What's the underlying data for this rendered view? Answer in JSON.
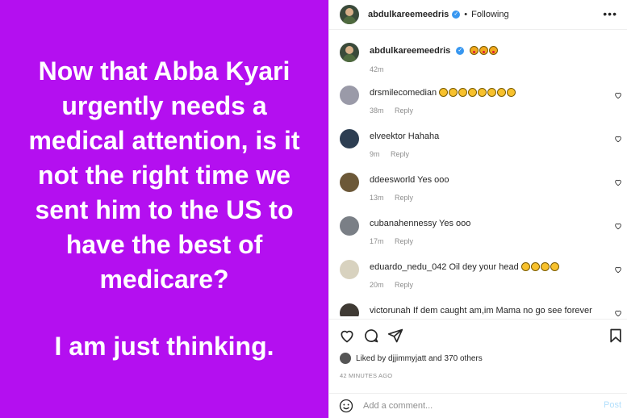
{
  "post": {
    "background_color": "#b40ff0",
    "text_main": "Now that Abba Kyari\nurgently needs a\nmedical attention, is it\nnot the right time we\nsent him to the US to\nhave the best of\nmedicare?",
    "text_secondary": "I am just thinking."
  },
  "header": {
    "username": "abdulkareemeedris",
    "separator": "•",
    "following_label": "Following"
  },
  "caption": {
    "username": "abdulkareemeedris",
    "time": "42m"
  },
  "comments": [
    {
      "username": "drsmilecomedian",
      "text": "",
      "time": "38m",
      "reply": "Reply"
    },
    {
      "username": "elveektor",
      "text": "Hahaha",
      "time": "9m",
      "reply": "Reply"
    },
    {
      "username": "ddeesworld",
      "text": "Yes ooo",
      "time": "13m",
      "reply": "Reply"
    },
    {
      "username": "cubanahennessy",
      "text": "Yes ooo",
      "time": "17m",
      "reply": "Reply"
    },
    {
      "username": "eduardo_nedu_042",
      "text": "Oil dey your head",
      "time": "20m",
      "reply": "Reply"
    },
    {
      "username": "victorunah",
      "text": "If dem caught am,im Mama no go see forever",
      "time": "",
      "reply": ""
    }
  ],
  "likes": {
    "prefix": "Liked by",
    "user": "djjimmyjatt",
    "suffix": "and 370 others"
  },
  "posted_ago": "42 MINUTES AGO",
  "add_comment": {
    "placeholder": "Add a comment...",
    "post_label": "Post"
  },
  "colors": {
    "accent_blue": "#3897f0",
    "muted_text": "#8e8e8e"
  }
}
